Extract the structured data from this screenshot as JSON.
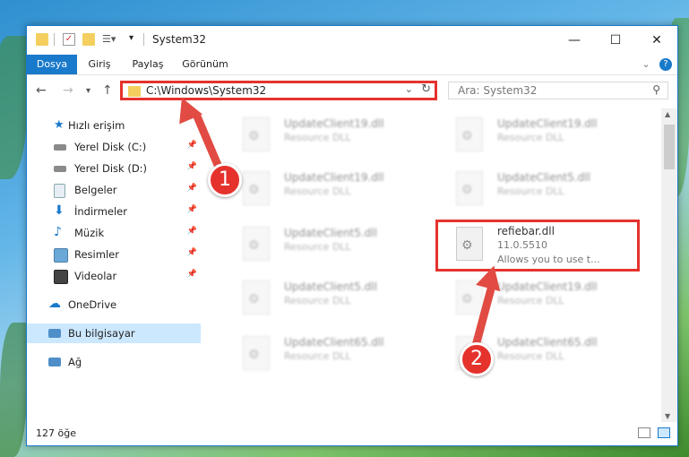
{
  "window": {
    "title": "System32"
  },
  "ribbon": {
    "tabs": [
      "Dosya",
      "Giriş",
      "Paylaş",
      "Görünüm"
    ]
  },
  "address": {
    "path": "C:\\Windows\\System32"
  },
  "search": {
    "placeholder": "Ara: System32"
  },
  "sidebar": {
    "items": [
      {
        "label": "Hızlı erişim",
        "icon": "star-icon",
        "pinned": false
      },
      {
        "label": "Yerel Disk (C:)",
        "icon": "drive-icon",
        "pinned": true
      },
      {
        "label": "Yerel Disk (D:)",
        "icon": "drive-icon",
        "pinned": true
      },
      {
        "label": "Belgeler",
        "icon": "documents-icon",
        "pinned": true
      },
      {
        "label": "İndirmeler",
        "icon": "download-icon",
        "pinned": true
      },
      {
        "label": "Müzik",
        "icon": "music-icon",
        "pinned": true
      },
      {
        "label": "Resimler",
        "icon": "pictures-icon",
        "pinned": true
      },
      {
        "label": "Videolar",
        "icon": "videos-icon",
        "pinned": true
      },
      {
        "label": "OneDrive",
        "icon": "cloud-icon",
        "pinned": false
      },
      {
        "label": "Bu bilgisayar",
        "icon": "computer-icon",
        "pinned": false
      },
      {
        "label": "Ağ",
        "icon": "network-icon",
        "pinned": false
      }
    ]
  },
  "files": [
    {
      "name": "UpdateClient19.dll",
      "sub": "Resource DLL"
    },
    {
      "name": "UpdateClient19.dll",
      "sub": "Resource DLL"
    },
    {
      "name": "UpdateClient19.dll",
      "sub": "Resource DLL"
    },
    {
      "name": "UpdateClient5.dll",
      "sub": "Resource DLL"
    },
    {
      "name": "UpdateClient5.dll",
      "sub": "Resource DLL"
    },
    {
      "name": "refiebar.dll",
      "sub": "11.0.5510",
      "desc": "Allows you to use t..."
    },
    {
      "name": "UpdateClient5.dll",
      "sub": "Resource DLL"
    },
    {
      "name": "UpdateClient19.dll",
      "sub": "Resource DLL"
    },
    {
      "name": "UpdateClient65.dll",
      "sub": "Resource DLL"
    },
    {
      "name": "UpdateClient65.dll",
      "sub": "Resource DLL"
    }
  ],
  "status": {
    "count": "127 öğe"
  },
  "annotations": {
    "badge1": "1",
    "badge2": "2"
  },
  "colors": {
    "accent": "#1979ca",
    "highlight": "#e5322d",
    "selected": "#cce8ff"
  }
}
